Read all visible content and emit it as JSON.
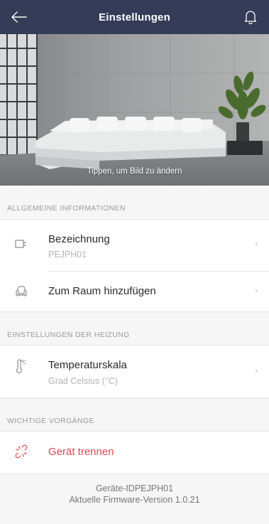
{
  "header": {
    "title": "Einstellungen",
    "back_icon": "arrow-left-icon",
    "bell_icon": "bell-icon",
    "background_color": "#343c57"
  },
  "hero": {
    "caption": "Tippen, um Bild zu ändern"
  },
  "sections": [
    {
      "title": "ALLGEMEINE INFORMATIONEN",
      "items": [
        {
          "label": "Bezeichnung",
          "value": "PEJPH01",
          "icon": "plug-icon"
        },
        {
          "label": "Zum Raum hinzufügen",
          "icon": "armchair-icon"
        }
      ]
    },
    {
      "title": "EINSTELLUNGEN DER HEIZUNG",
      "items": [
        {
          "label": "Temperaturskala",
          "value": "Grad Celsius (°C)",
          "icon": "thermometer-celsius-icon"
        }
      ]
    },
    {
      "title": "WICHTIGE VORGÄNGE",
      "items": [
        {
          "label": "Gerät trennen",
          "icon": "broken-link-icon",
          "color": "#e3464e"
        }
      ]
    }
  ],
  "footer": {
    "device_id": "Geräte-IDPEJPH01",
    "firmware": "Aktuelle Firmware-Version 1.0.21"
  },
  "colors": {
    "accent_danger": "#e3464e",
    "muted_text": "#b5b5ba",
    "section_bg": "#f6f6f7"
  }
}
